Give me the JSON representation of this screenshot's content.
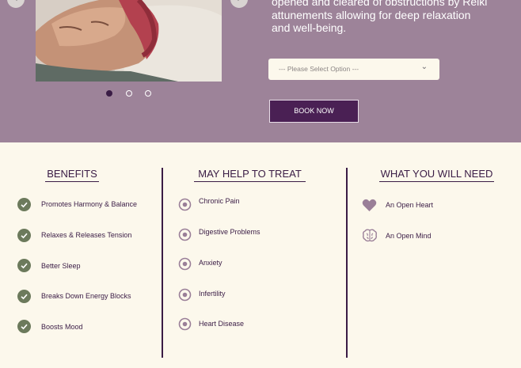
{
  "hero": {
    "description_line1": "opened and cleared of obstructions by Reiki",
    "description_line2": "attunements allowing for deep relaxation",
    "description_line3": "and well-being.",
    "select_placeholder": "--- Please Select Option ---",
    "book_button": "BOOK NOW"
  },
  "carousel": {
    "slide_count": 3,
    "active_index": 0
  },
  "benefits": {
    "title": "BENEFITS",
    "items": [
      "Promotes Harmony & Balance",
      "Relaxes & Releases Tension",
      "Better Sleep",
      "Breaks Down Energy Blocks",
      "Boosts Mood"
    ]
  },
  "treat": {
    "title": "MAY HELP TO TREAT",
    "items": [
      "Chronic Pain",
      "Digestive Problems",
      "Anxiety",
      "Infertility",
      "Heart Disease"
    ]
  },
  "need": {
    "title": "WHAT YOU WILL NEED",
    "items": [
      {
        "icon": "heart-icon",
        "label": "An Open Heart"
      },
      {
        "icon": "brain-icon",
        "label": "An Open Mind"
      }
    ]
  },
  "colors": {
    "hero_bg": "#9d8399",
    "page_bg": "#fcf8ec",
    "primary": "#4a2054",
    "check": "#6c7a5c",
    "icon": "#9a7f98"
  }
}
